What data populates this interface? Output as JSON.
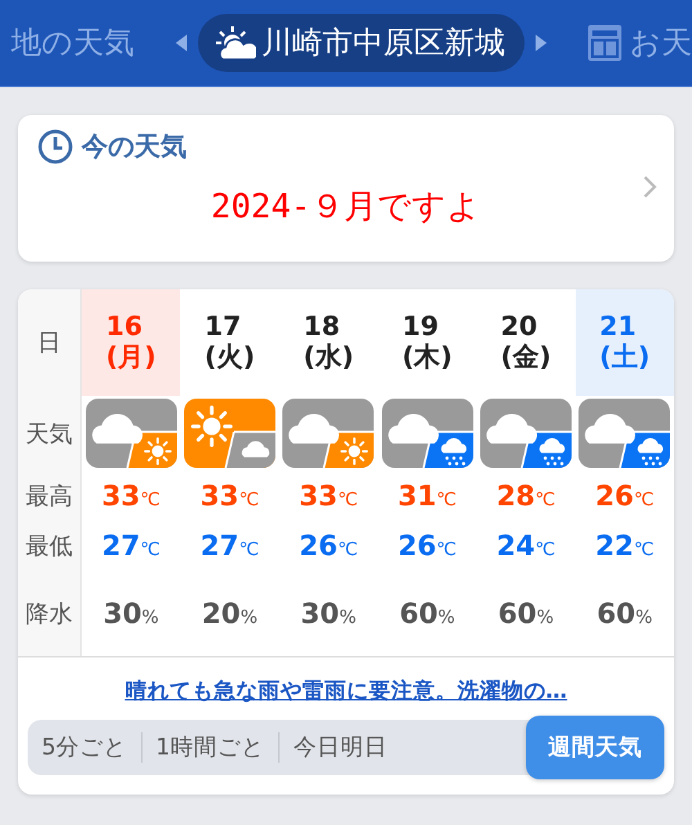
{
  "header": {
    "prev_label": "地の天気",
    "location": "川崎市中原区新城",
    "next_label": "お天"
  },
  "now_card": {
    "title": "今の天気",
    "message": "2024-９月ですよ"
  },
  "forecast": {
    "row_labels": {
      "date": "日",
      "weather": "天気",
      "high": "最高",
      "low": "最低",
      "rain": "降水"
    },
    "days": [
      {
        "day": "16",
        "weekday": "(月)",
        "kind": "holiday",
        "weather": {
          "kind": "cloudy-sunny"
        },
        "high": "33",
        "low": "27",
        "rain": "30"
      },
      {
        "day": "17",
        "weekday": "(火)",
        "kind": "weekday",
        "weather": {
          "kind": "sunny-cloudy"
        },
        "high": "33",
        "low": "27",
        "rain": "20"
      },
      {
        "day": "18",
        "weekday": "(水)",
        "kind": "weekday",
        "weather": {
          "kind": "cloudy-sunny"
        },
        "high": "33",
        "low": "26",
        "rain": "30"
      },
      {
        "day": "19",
        "weekday": "(木)",
        "kind": "weekday",
        "weather": {
          "kind": "cloudy-rain"
        },
        "high": "31",
        "low": "26",
        "rain": "60"
      },
      {
        "day": "20",
        "weekday": "(金)",
        "kind": "weekday",
        "weather": {
          "kind": "cloudy-rain"
        },
        "high": "28",
        "low": "24",
        "rain": "60"
      },
      {
        "day": "21",
        "weekday": "(土)",
        "kind": "saturday",
        "weather": {
          "kind": "cloudy-rain"
        },
        "high": "26",
        "low": "22",
        "rain": "60"
      }
    ],
    "temp_unit": "℃",
    "rain_unit": "%",
    "summary_link": "晴れても急な雨や雷雨に要注意。洗濯物の…",
    "tabs": [
      {
        "label": "5分ごと",
        "selected": false
      },
      {
        "label": "1時間ごと",
        "selected": false
      },
      {
        "label": "今日明日",
        "selected": false
      },
      {
        "label": "週間天気",
        "selected": true
      }
    ]
  }
}
